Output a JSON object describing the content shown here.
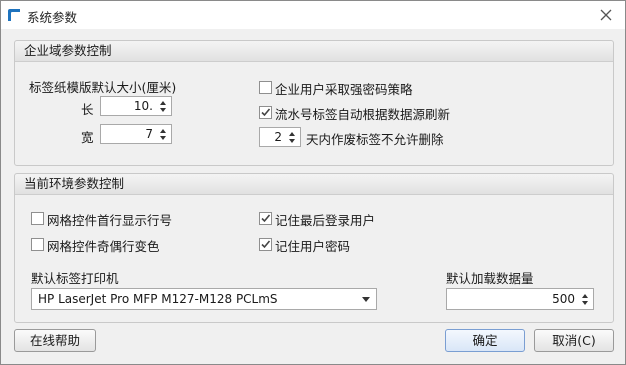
{
  "window": {
    "title": "系统参数",
    "close_label": "close"
  },
  "enterprise": {
    "header": "企业域参数控制",
    "label_size_caption": "标签纸模版默认大小(厘米)",
    "length_label": "长",
    "length_value": "10.",
    "width_label": "宽",
    "width_value": "7",
    "force_strong_password": {
      "label": "企业用户采取强密码策略",
      "checked": false
    },
    "serial_auto_refresh": {
      "label": "流水号标签自动根据数据源刷新",
      "checked": true
    },
    "no_delete_days_value": "2",
    "no_delete_days_label": "天内作废标签不允许删除"
  },
  "environment": {
    "header": "当前环境参数控制",
    "grid_first_row_show_row_number": {
      "label": "网格控件首行显示行号",
      "checked": false
    },
    "remember_last_login_user": {
      "label": "记住最后登录用户",
      "checked": true
    },
    "grid_odd_even_row_color": {
      "label": "网格控件奇偶行变色",
      "checked": false
    },
    "remember_user_password": {
      "label": "记住用户密码",
      "checked": true
    },
    "default_printer_label": "默认标签打印机",
    "default_printer_value": "HP LaserJet Pro MFP M127-M128 PCLmS",
    "default_load_count_label": "默认加载数据量",
    "default_load_count_value": "500"
  },
  "footer": {
    "help_button": "在线帮助",
    "ok_button": "确定",
    "cancel_button": "取消(C)"
  },
  "colors": {
    "accent": "#1e73be",
    "check": "#444444"
  }
}
